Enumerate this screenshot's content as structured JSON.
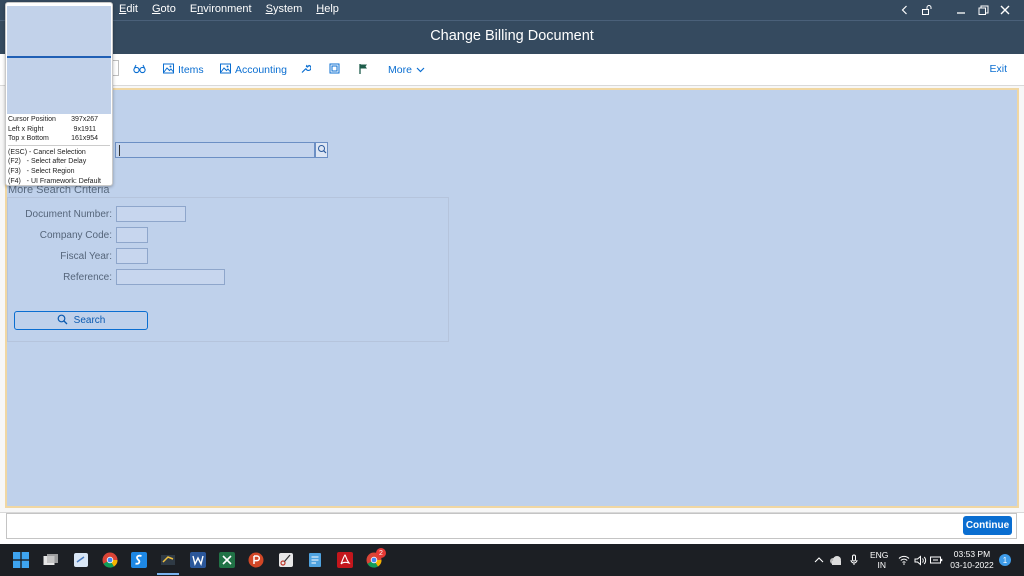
{
  "menu": {
    "items": [
      {
        "prefix": "",
        "key": "E",
        "rest": "dit"
      },
      {
        "prefix": "",
        "key": "G",
        "rest": "oto"
      },
      {
        "prefix": "E",
        "key": "n",
        "rest": "vironment"
      },
      {
        "prefix": "",
        "key": "S",
        "rest": "ystem"
      },
      {
        "prefix": "",
        "key": "H",
        "rest": "elp"
      }
    ]
  },
  "window": {
    "title": "Change Billing Document"
  },
  "toolbar": {
    "items_label": "Items",
    "accounting_label": "Accounting",
    "more_label": "More",
    "exit_label": "Exit"
  },
  "search": {
    "section_title": "More Search Criteria",
    "fields": {
      "document_number": {
        "label": "Document Number:",
        "value": ""
      },
      "company_code": {
        "label": "Company Code:",
        "value": ""
      },
      "fiscal_year": {
        "label": "Fiscal Year:",
        "value": ""
      },
      "reference": {
        "label": "Reference:",
        "value": ""
      }
    },
    "button_label": "Search"
  },
  "footer": {
    "continue_label": "Continue"
  },
  "snip": {
    "rows": [
      {
        "label": "Cursor Position",
        "value": "397x267"
      },
      {
        "label": "Left x Right",
        "value": "9x1911"
      },
      {
        "label": "Top x Bottom",
        "value": "161x954"
      }
    ],
    "shortcuts": [
      "(ESC) - Cancel Selection",
      "(F2)   - Select after Delay",
      "(F3)   - Select Region",
      "(F4)   - UI Framework: Default"
    ]
  },
  "taskbar": {
    "lang_top": "ENG",
    "lang_bottom": "IN",
    "time": "03:53 PM",
    "date": "03-10-2022",
    "notification_count": "1",
    "chrome_badge": "2"
  },
  "colors": {
    "shell": "#354a5f",
    "accent": "#0a6ed1",
    "selection_tint": "#b0c6e8"
  }
}
